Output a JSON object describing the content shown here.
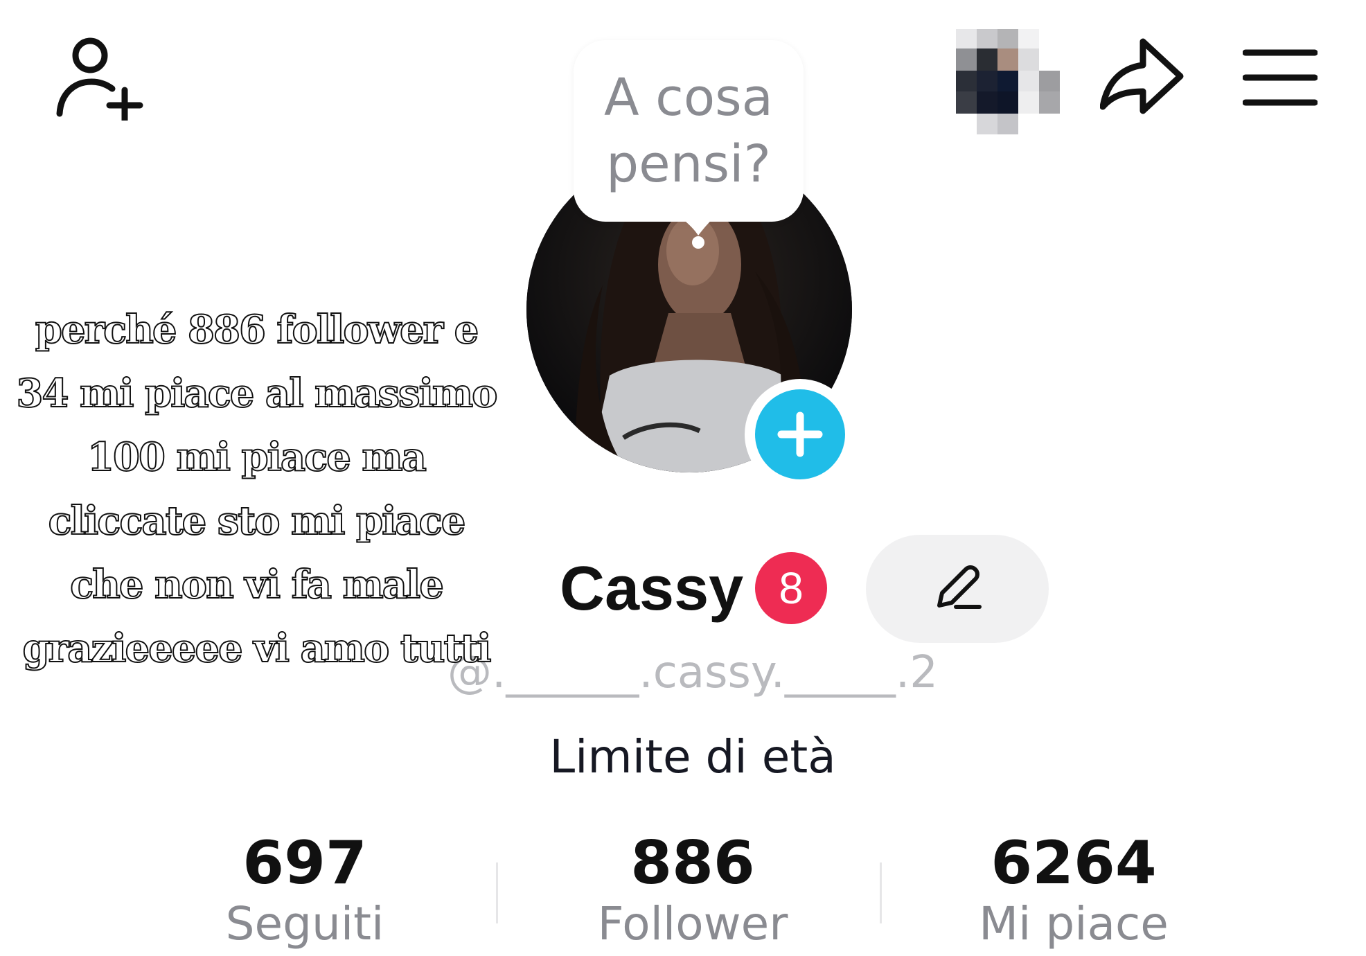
{
  "topbar": {
    "icons": [
      "add-friend-icon",
      "pixelated-avatar-thumbnail",
      "share-icon",
      "menu-icon"
    ]
  },
  "note": {
    "placeholder": "A cosa\npensi?"
  },
  "overlay_caption": "perché 886 follower e 34 mi piace al massimo 100 mi piace ma cliccate sto mi piace che non vi fa male grazieeeee vi amo tutti",
  "profile": {
    "display_name": "Cassy",
    "notification_count": "8",
    "username": "@.______.cassy._____.2",
    "bio": "Limite di età"
  },
  "stats": [
    {
      "value": "697",
      "label": "Seguiti"
    },
    {
      "value": "886",
      "label": "Follower"
    },
    {
      "value": "6264",
      "label": "Mi piace"
    }
  ],
  "colors": {
    "accent_blue": "#20bde8",
    "badge_red": "#ee2c53",
    "muted_text": "#8a8b91"
  }
}
